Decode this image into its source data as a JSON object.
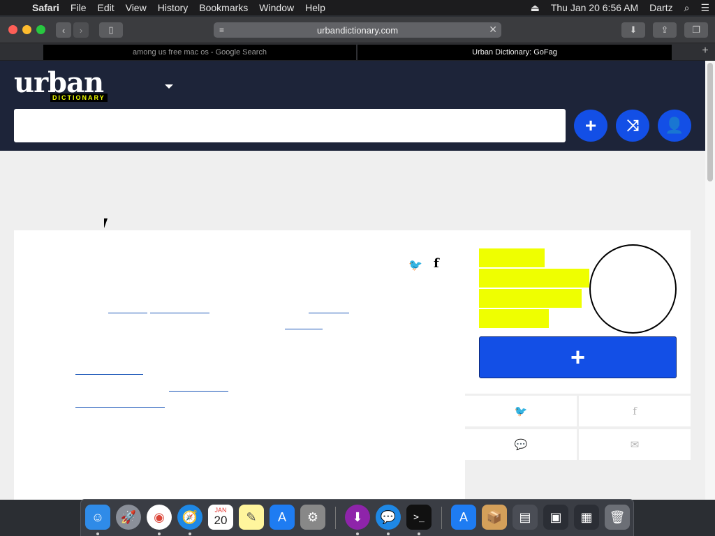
{
  "menubar": {
    "apple": "",
    "app_name": "Safari",
    "items": [
      "File",
      "Edit",
      "View",
      "History",
      "Bookmarks",
      "Window",
      "Help"
    ],
    "clock": "Thu Jan 20  6:56 AM",
    "user": "Dartz"
  },
  "toolbar": {
    "url": "urbandictionary.com"
  },
  "tabs": {
    "inactive": "among us free mac os - Google Search",
    "active": "Urban Dictionary: GoFag"
  },
  "site": {
    "logo_word": "urban",
    "logo_sub": "DICTIONARY",
    "search_placeholder": ""
  },
  "dock": {
    "calendar_month": "JAN",
    "calendar_day": "20"
  },
  "colors": {
    "header_bg": "#1d2439",
    "brand_blue": "#134fe6",
    "highlight_yellow": "#efff00"
  }
}
